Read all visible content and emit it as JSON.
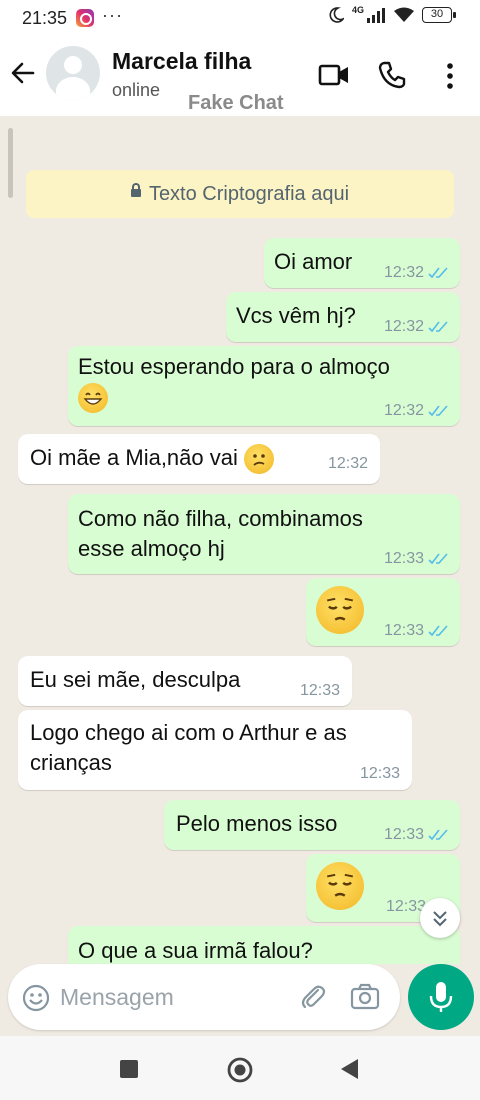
{
  "status_bar": {
    "time": "21:35",
    "more": "···",
    "network": "4G",
    "battery": "30"
  },
  "header": {
    "contact_name": "Marcela filha",
    "contact_status": "online",
    "watermark": "Fake Chat"
  },
  "encryption_notice": "Texto Criptografia aqui",
  "messages": [
    {
      "dir": "out",
      "text": "Oi amor",
      "time": "12:32",
      "read": true
    },
    {
      "dir": "out",
      "text": "Vcs vêm hj?",
      "time": "12:32",
      "read": true
    },
    {
      "dir": "out",
      "text": "Estou esperando para o almoço",
      "emoji": "grinning-face",
      "time": "12:32",
      "read": true
    },
    {
      "dir": "in",
      "text": "Oi mãe a Mia,não vai",
      "emoji": "confused-face",
      "time": "12:32"
    },
    {
      "dir": "out",
      "text": "Como não filha, combinamos\nesse almoço hj",
      "time": "12:33",
      "read": true
    },
    {
      "dir": "out",
      "text": "",
      "emoji": "pensive-face",
      "time": "12:33",
      "read": true
    },
    {
      "dir": "in",
      "text": "Eu sei mãe, desculpa",
      "time": "12:33"
    },
    {
      "dir": "in",
      "text": "Logo chego ai com o Arthur e as\ncrianças",
      "time": "12:33"
    },
    {
      "dir": "out",
      "text": "Pelo menos isso",
      "time": "12:33",
      "read": true
    },
    {
      "dir": "out",
      "text": "",
      "emoji": "pensive-face",
      "time": "12:33",
      "read": true
    },
    {
      "dir": "out",
      "text": "O que a sua irmã falou?",
      "time": ""
    }
  ],
  "input": {
    "placeholder": "Mensagem"
  },
  "colors": {
    "outgoing_bubble": "#d9fdd3",
    "incoming_bubble": "#ffffff",
    "chat_bg": "#efeae2",
    "accent": "#00a884",
    "read_ticks": "#53bdeb",
    "encryption_bg": "#fdf4c5"
  },
  "icons": [
    "back-arrow-icon",
    "avatar-icon",
    "video-call-icon",
    "phone-icon",
    "more-vert-icon",
    "lock-icon",
    "double-check-icon",
    "scroll-down-icon",
    "emoji-icon",
    "attach-icon",
    "camera-icon",
    "mic-icon",
    "nav-recents-icon",
    "nav-home-icon",
    "nav-back-icon"
  ]
}
